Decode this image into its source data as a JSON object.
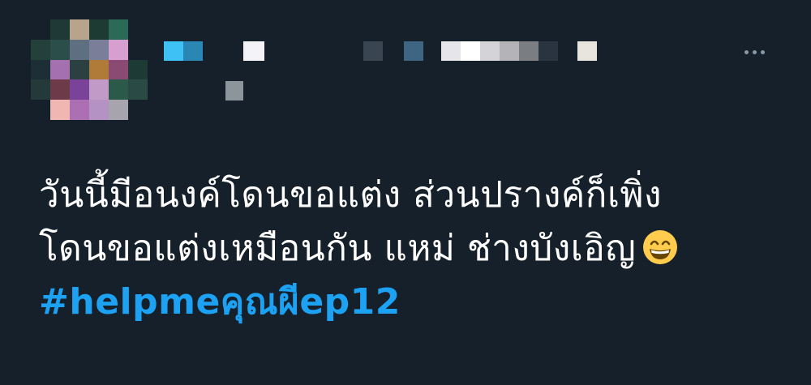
{
  "tweet": {
    "line1": "วันนี้มีอนงค์โดนขอแต่ง ส่วนปรางค์ก็เพิ่ง",
    "line2": "โดนขอแต่งเหมือนกัน แหม่ ช่างบังเอิญ",
    "emoji": "grinning-face-with-smiling-eyes",
    "hashtag": "#helpmeคุณผีep12"
  },
  "author": {
    "avatar": "pixelated-avatar",
    "name_obscured": true,
    "handle_obscured": true
  },
  "icons": {
    "more": "more-horizontal-icon"
  },
  "colors": {
    "background": "#15202b",
    "text": "#ffffff",
    "link": "#1da1f2",
    "muted": "#8899a6"
  }
}
